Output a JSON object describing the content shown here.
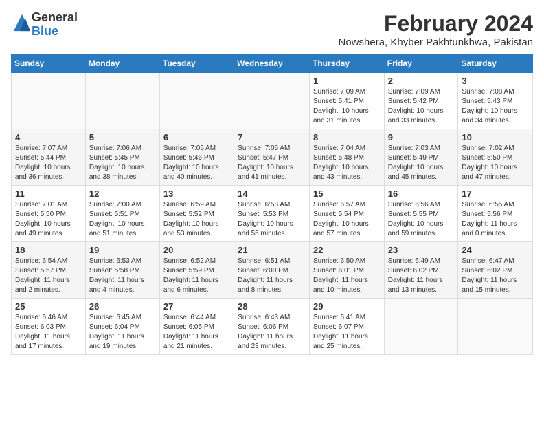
{
  "logo": {
    "general": "General",
    "blue": "Blue"
  },
  "header": {
    "month": "February 2024",
    "location": "Nowshera, Khyber Pakhtunkhwa, Pakistan"
  },
  "weekdays": [
    "Sunday",
    "Monday",
    "Tuesday",
    "Wednesday",
    "Thursday",
    "Friday",
    "Saturday"
  ],
  "weeks": [
    [
      {
        "day": "",
        "info": ""
      },
      {
        "day": "",
        "info": ""
      },
      {
        "day": "",
        "info": ""
      },
      {
        "day": "",
        "info": ""
      },
      {
        "day": "1",
        "info": "Sunrise: 7:09 AM\nSunset: 5:41 PM\nDaylight: 10 hours\nand 31 minutes."
      },
      {
        "day": "2",
        "info": "Sunrise: 7:09 AM\nSunset: 5:42 PM\nDaylight: 10 hours\nand 33 minutes."
      },
      {
        "day": "3",
        "info": "Sunrise: 7:08 AM\nSunset: 5:43 PM\nDaylight: 10 hours\nand 34 minutes."
      }
    ],
    [
      {
        "day": "4",
        "info": "Sunrise: 7:07 AM\nSunset: 5:44 PM\nDaylight: 10 hours\nand 36 minutes."
      },
      {
        "day": "5",
        "info": "Sunrise: 7:06 AM\nSunset: 5:45 PM\nDaylight: 10 hours\nand 38 minutes."
      },
      {
        "day": "6",
        "info": "Sunrise: 7:05 AM\nSunset: 5:46 PM\nDaylight: 10 hours\nand 40 minutes."
      },
      {
        "day": "7",
        "info": "Sunrise: 7:05 AM\nSunset: 5:47 PM\nDaylight: 10 hours\nand 41 minutes."
      },
      {
        "day": "8",
        "info": "Sunrise: 7:04 AM\nSunset: 5:48 PM\nDaylight: 10 hours\nand 43 minutes."
      },
      {
        "day": "9",
        "info": "Sunrise: 7:03 AM\nSunset: 5:49 PM\nDaylight: 10 hours\nand 45 minutes."
      },
      {
        "day": "10",
        "info": "Sunrise: 7:02 AM\nSunset: 5:50 PM\nDaylight: 10 hours\nand 47 minutes."
      }
    ],
    [
      {
        "day": "11",
        "info": "Sunrise: 7:01 AM\nSunset: 5:50 PM\nDaylight: 10 hours\nand 49 minutes."
      },
      {
        "day": "12",
        "info": "Sunrise: 7:00 AM\nSunset: 5:51 PM\nDaylight: 10 hours\nand 51 minutes."
      },
      {
        "day": "13",
        "info": "Sunrise: 6:59 AM\nSunset: 5:52 PM\nDaylight: 10 hours\nand 53 minutes."
      },
      {
        "day": "14",
        "info": "Sunrise: 6:58 AM\nSunset: 5:53 PM\nDaylight: 10 hours\nand 55 minutes."
      },
      {
        "day": "15",
        "info": "Sunrise: 6:57 AM\nSunset: 5:54 PM\nDaylight: 10 hours\nand 57 minutes."
      },
      {
        "day": "16",
        "info": "Sunrise: 6:56 AM\nSunset: 5:55 PM\nDaylight: 10 hours\nand 59 minutes."
      },
      {
        "day": "17",
        "info": "Sunrise: 6:55 AM\nSunset: 5:56 PM\nDaylight: 11 hours\nand 0 minutes."
      }
    ],
    [
      {
        "day": "18",
        "info": "Sunrise: 6:54 AM\nSunset: 5:57 PM\nDaylight: 11 hours\nand 2 minutes."
      },
      {
        "day": "19",
        "info": "Sunrise: 6:53 AM\nSunset: 5:58 PM\nDaylight: 11 hours\nand 4 minutes."
      },
      {
        "day": "20",
        "info": "Sunrise: 6:52 AM\nSunset: 5:59 PM\nDaylight: 11 hours\nand 6 minutes."
      },
      {
        "day": "21",
        "info": "Sunrise: 6:51 AM\nSunset: 6:00 PM\nDaylight: 11 hours\nand 8 minutes."
      },
      {
        "day": "22",
        "info": "Sunrise: 6:50 AM\nSunset: 6:01 PM\nDaylight: 11 hours\nand 10 minutes."
      },
      {
        "day": "23",
        "info": "Sunrise: 6:49 AM\nSunset: 6:02 PM\nDaylight: 11 hours\nand 13 minutes."
      },
      {
        "day": "24",
        "info": "Sunrise: 6:47 AM\nSunset: 6:02 PM\nDaylight: 11 hours\nand 15 minutes."
      }
    ],
    [
      {
        "day": "25",
        "info": "Sunrise: 6:46 AM\nSunset: 6:03 PM\nDaylight: 11 hours\nand 17 minutes."
      },
      {
        "day": "26",
        "info": "Sunrise: 6:45 AM\nSunset: 6:04 PM\nDaylight: 11 hours\nand 19 minutes."
      },
      {
        "day": "27",
        "info": "Sunrise: 6:44 AM\nSunset: 6:05 PM\nDaylight: 11 hours\nand 21 minutes."
      },
      {
        "day": "28",
        "info": "Sunrise: 6:43 AM\nSunset: 6:06 PM\nDaylight: 11 hours\nand 23 minutes."
      },
      {
        "day": "29",
        "info": "Sunrise: 6:41 AM\nSunset: 6:07 PM\nDaylight: 11 hours\nand 25 minutes."
      },
      {
        "day": "",
        "info": ""
      },
      {
        "day": "",
        "info": ""
      }
    ]
  ]
}
